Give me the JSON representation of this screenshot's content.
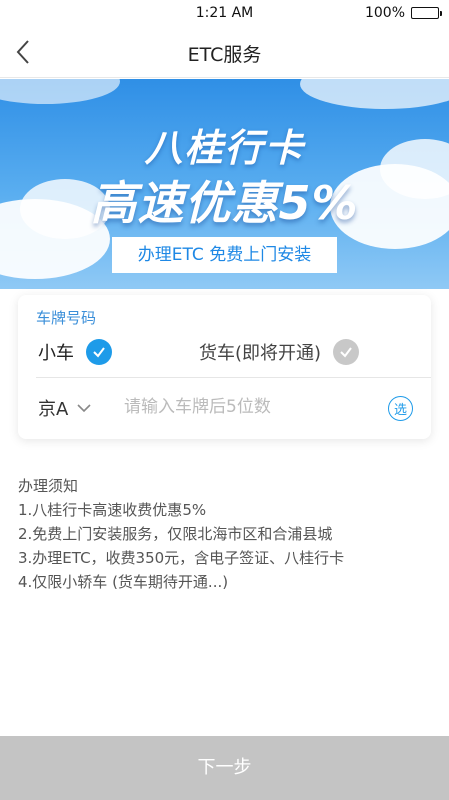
{
  "status_bar": {
    "time": "1:21 AM",
    "battery": "100%"
  },
  "nav": {
    "title": "ETC服务"
  },
  "banner": {
    "line1": "八桂行卡",
    "line2": "高速优惠5%",
    "tag": "办理ETC 免费上门安装"
  },
  "plate_form": {
    "label": "车牌号码",
    "vehicle_types": [
      {
        "label": "小车",
        "selected": true
      },
      {
        "label": "货车(即将开通)",
        "selected": false
      }
    ],
    "province": "京A",
    "input_placeholder": "请输入车牌后5位数",
    "input_value": "",
    "select_label": "选"
  },
  "notice": {
    "title": "办理须知",
    "items": [
      "1.八桂行卡高速收费优惠5%",
      "2.免费上门安装服务，仅限北海市区和合浦县城",
      "3.办理ETC，收费350元，含电子签证、八桂行卡",
      "4.仅限小轿车 (货车期待开通...)"
    ]
  },
  "footer": {
    "next_label": "下一步"
  },
  "colors": {
    "accent": "#1e9be9",
    "label_blue": "#3b8fd9",
    "disabled_gray": "#c4c4c4",
    "banner_top": "#2f8fe6",
    "banner_bottom": "#8fc9f5"
  },
  "icons": [
    "back-chevron-icon",
    "check-circle-icon",
    "chevron-down-icon",
    "battery-icon"
  ]
}
